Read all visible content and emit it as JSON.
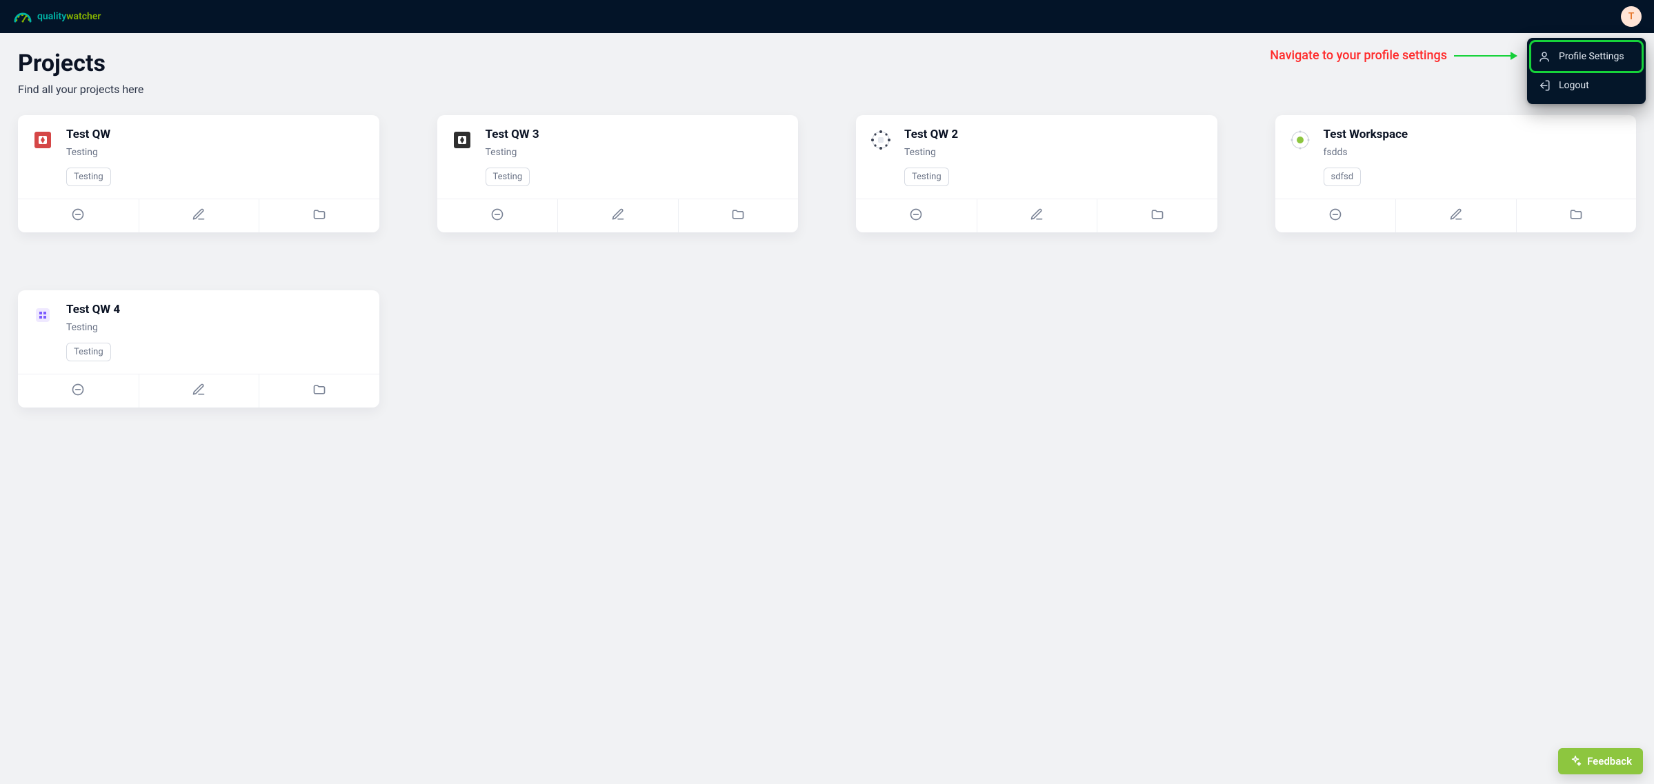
{
  "header": {
    "brand_q": "quality",
    "brand_w": "watcher",
    "avatar_initial": "T"
  },
  "user_menu": {
    "profile_label": "Profile Settings",
    "logout_label": "Logout"
  },
  "callout": {
    "text": "Navigate to your profile settings"
  },
  "page": {
    "title": "Projects",
    "subtitle": "Find all your projects here"
  },
  "projects": [
    {
      "title": "Test QW",
      "subtitle": "Testing",
      "tags": [
        "Testing"
      ],
      "icon": "qw-red"
    },
    {
      "title": "Test QW 3",
      "subtitle": "Testing",
      "tags": [
        "Testing"
      ],
      "icon": "qw-dark"
    },
    {
      "title": "Test QW 2",
      "subtitle": "Testing",
      "tags": [
        "Testing"
      ],
      "icon": "qw-dots"
    },
    {
      "title": "Test Workspace",
      "subtitle": "fsdds",
      "tags": [
        "sdfsd"
      ],
      "icon": "qw-green"
    },
    {
      "title": "Test QW 4",
      "subtitle": "Testing",
      "tags": [
        "Testing"
      ],
      "icon": "qw-purple"
    }
  ],
  "feedback": {
    "label": "Feedback"
  }
}
